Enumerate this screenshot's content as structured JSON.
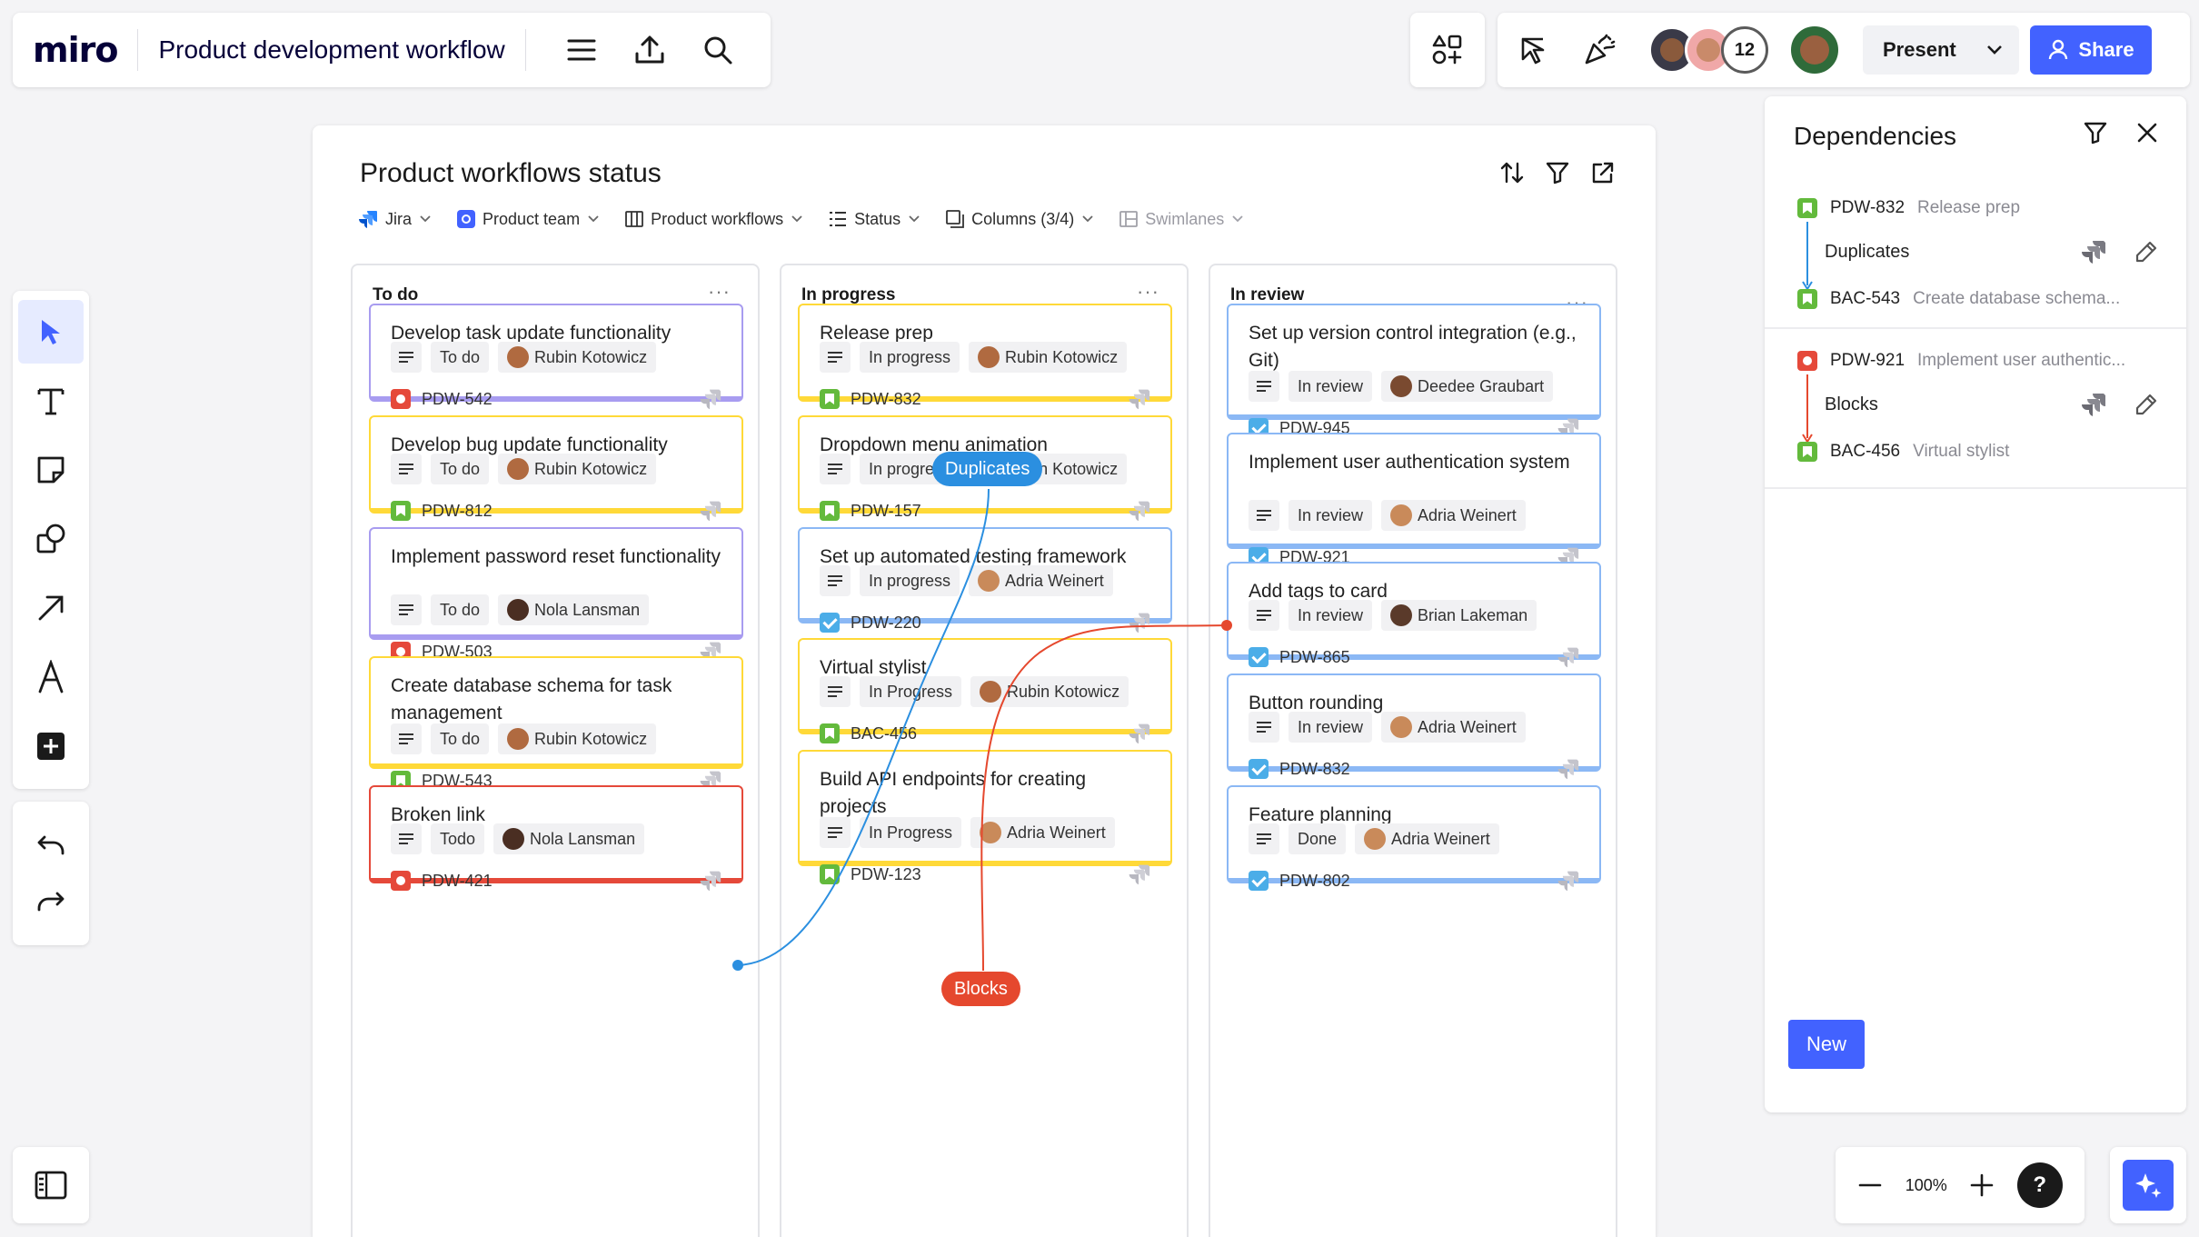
{
  "app": {
    "logo": "miro",
    "board_title": "Product development workflow"
  },
  "toolbar_right": {
    "collaborator_count": "12",
    "present_label": "Present",
    "share_label": "Share"
  },
  "widget": {
    "title": "Product workflows status",
    "filters": [
      {
        "label": "Jira"
      },
      {
        "label": "Product team"
      },
      {
        "label": "Product workflows"
      },
      {
        "label": "Status"
      },
      {
        "label": "Columns (3/4)"
      },
      {
        "label": "Swimlanes"
      }
    ],
    "columns": [
      {
        "title": "To do",
        "cards": [
          {
            "title": "Develop task update functionality",
            "status": "To do",
            "assignee": "Rubin Kotowicz",
            "key": "PDW-542",
            "type": "bug"
          },
          {
            "title": "Develop bug update functionality",
            "status": "To do",
            "assignee": "Rubin Kotowicz",
            "key": "PDW-812",
            "type": "story"
          },
          {
            "title": "Implement password reset functionality",
            "status": "To do",
            "assignee": "Nola Lansman",
            "key": "PDW-503",
            "type": "bug"
          },
          {
            "title": "Create database schema for task management",
            "status": "To do",
            "assignee": "Rubin Kotowicz",
            "key": "PDW-543",
            "type": "story"
          },
          {
            "title": "Broken link",
            "status": "Todo",
            "assignee": "Nola Lansman",
            "key": "PDW-421",
            "type": "bug"
          }
        ]
      },
      {
        "title": "In progress",
        "cards": [
          {
            "title": "Release prep",
            "status": "In progress",
            "assignee": "Rubin Kotowicz",
            "key": "PDW-832",
            "type": "story"
          },
          {
            "title": "Dropdown menu animation",
            "status": "In progress",
            "assignee": "Rubin Kotowicz",
            "key": "PDW-157",
            "type": "story"
          },
          {
            "title": "Set up automated testing framework",
            "status": "In progress",
            "assignee": "Adria Weinert",
            "key": "PDW-220",
            "type": "task"
          },
          {
            "title": "Virtual stylist",
            "status": "In Progress",
            "assignee": "Rubin Kotowicz",
            "key": "BAC-456",
            "type": "story"
          },
          {
            "title": "Build API endpoints for creating projects",
            "status": "In Progress",
            "assignee": "Adria Weinert",
            "key": "PDW-123",
            "type": "story"
          }
        ]
      },
      {
        "title": "In review",
        "cards": [
          {
            "title": "Set up version control integration (e.g., Git)",
            "status": "In review",
            "assignee": "Deedee Graubart",
            "key": "PDW-945",
            "type": "task"
          },
          {
            "title": "Implement user authentication system",
            "status": "In review",
            "assignee": "Adria Weinert",
            "key": "PDW-921",
            "type": "task"
          },
          {
            "title": "Add tags to card",
            "status": "In review",
            "assignee": "Brian Lakeman",
            "key": "PDW-865",
            "type": "task"
          },
          {
            "title": "Button rounding",
            "status": "In review",
            "assignee": "Adria Weinert",
            "key": "PDW-832",
            "type": "task"
          },
          {
            "title": "Feature planning",
            "status": "Done",
            "assignee": "Adria Weinert",
            "key": "PDW-802",
            "type": "task"
          }
        ]
      }
    ],
    "connector_labels": {
      "duplicates": "Duplicates",
      "blocks": "Blocks"
    }
  },
  "dependencies": {
    "title": "Dependencies",
    "items": [
      {
        "from_key": "PDW-832",
        "from_title": "Release prep",
        "relation": "Duplicates",
        "to_key": "BAC-543",
        "to_title": "Create database schema..."
      },
      {
        "from_key": "PDW-921",
        "from_title": "Implement user authentic...",
        "relation": "Blocks",
        "to_key": "BAC-456",
        "to_title": "Virtual stylist"
      }
    ],
    "new_label": "New"
  },
  "zoom": {
    "level": "100%"
  },
  "help_label": "?",
  "colors": {
    "accent": "#4262ff",
    "todo_purple": "#a89cf0",
    "yellow": "#ffd938",
    "blue": "#8bb8f5",
    "red": "#e5493a",
    "link_blue": "#2b8fe0",
    "link_red": "#e5482e"
  }
}
